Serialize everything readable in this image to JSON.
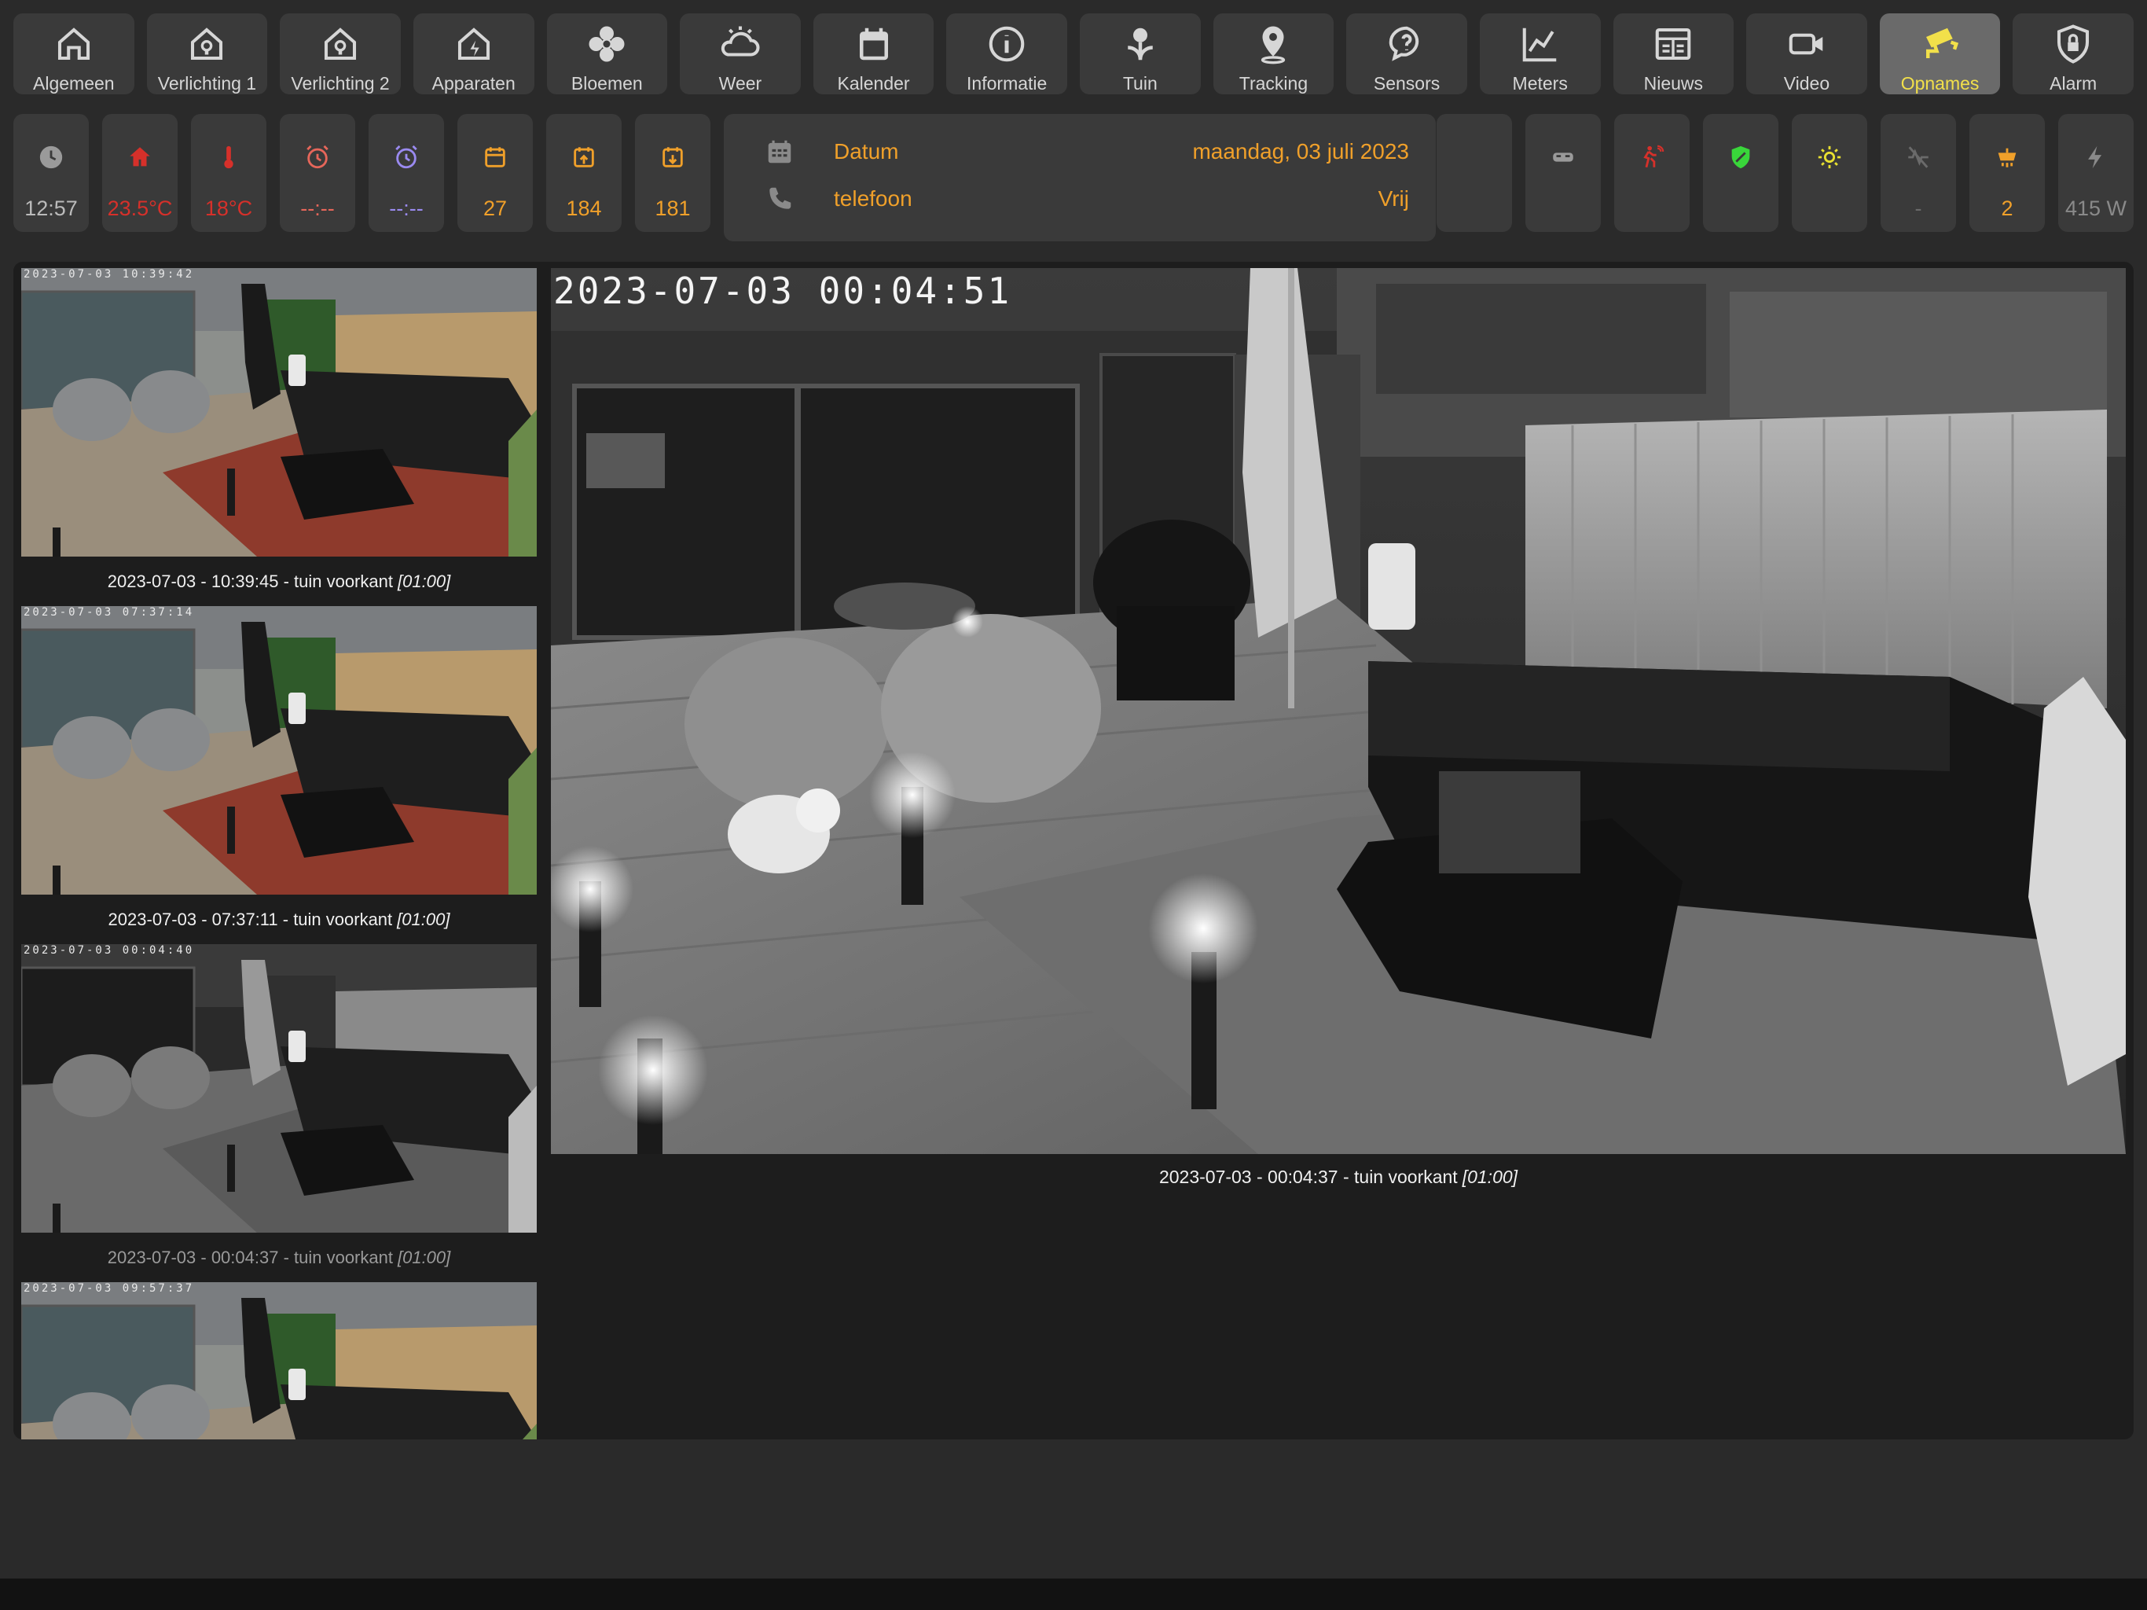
{
  "nav": {
    "tabs": [
      {
        "label": "Algemeen",
        "icon": "home-icon",
        "active": false
      },
      {
        "label": "Verlichting 1",
        "icon": "home-light-icon",
        "active": false
      },
      {
        "label": "Verlichting 2",
        "icon": "home-light-icon",
        "active": false
      },
      {
        "label": "Apparaten",
        "icon": "home-power-icon",
        "active": false
      },
      {
        "label": "Bloemen",
        "icon": "flower-icon",
        "active": false
      },
      {
        "label": "Weer",
        "icon": "weather-icon",
        "active": false
      },
      {
        "label": "Kalender",
        "icon": "calendar-icon",
        "active": false
      },
      {
        "label": "Informatie",
        "icon": "info-icon",
        "active": false
      },
      {
        "label": "Tuin",
        "icon": "garden-flower-icon",
        "active": false
      },
      {
        "label": "Tracking",
        "icon": "map-pin-icon",
        "active": false
      },
      {
        "label": "Sensors",
        "icon": "question-bubble-icon",
        "active": false
      },
      {
        "label": "Meters",
        "icon": "line-chart-icon",
        "active": false
      },
      {
        "label": "Nieuws",
        "icon": "newspaper-icon",
        "active": false
      },
      {
        "label": "Video",
        "icon": "video-camera-icon",
        "active": false
      },
      {
        "label": "Opnames",
        "icon": "cctv-icon",
        "active": true
      },
      {
        "label": "Alarm",
        "icon": "shield-lock-icon",
        "active": false
      }
    ]
  },
  "status": {
    "time": "12:57",
    "temp_inside": "23.5°C",
    "temp_outside": "18°C",
    "alarm1": "--:--",
    "alarm2": "--:--",
    "calendar_day": "27",
    "days_a": "184",
    "days_b": "181",
    "energy_count": "-",
    "lights_on": "2",
    "power": "415 W"
  },
  "info": {
    "date_label": "Datum",
    "date_value": "maandag, 03 juli 2023",
    "phone_label": "telefoon",
    "phone_value": "Vrij"
  },
  "colors": {
    "accent": "#f0a02a",
    "active_tab_text": "#f2e04a",
    "temp_red": "#d6302a",
    "alarm1": "#e6665a",
    "alarm2": "#9a8af0",
    "green_shield": "#39d63a",
    "sun_yellow": "#e8e030"
  },
  "recordings": [
    {
      "stamp": "2023-07-03 10:39:42",
      "caption": "2023-07-03 - 10:39:45 - tuin voorkant",
      "duration": "[01:00]",
      "scene": "day"
    },
    {
      "stamp": "2023-07-03 07:37:14",
      "caption": "2023-07-03 - 07:37:11 - tuin voorkant",
      "duration": "[01:00]",
      "scene": "day"
    },
    {
      "stamp": "2023-07-03 00:04:40",
      "caption": "2023-07-03 - 00:04:37 - tuin voorkant",
      "duration": "[01:00]",
      "scene": "night"
    },
    {
      "stamp": "2023-07-03 09:57:37",
      "caption": "",
      "duration": "",
      "scene": "day"
    }
  ],
  "viewer": {
    "stamp": "2023-07-03 00:04:51",
    "caption": "2023-07-03 - 00:04:37 - tuin voorkant",
    "duration": "[01:00]"
  }
}
